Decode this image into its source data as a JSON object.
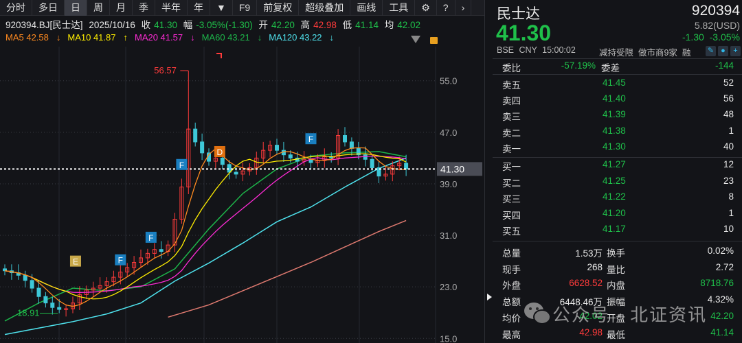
{
  "toolbar": {
    "items": [
      "分时",
      "多日",
      "日",
      "周",
      "月",
      "季",
      "半年",
      "年",
      "▼",
      "F9",
      "前复权",
      "超级叠加",
      "画线",
      "工具"
    ],
    "active": 2
  },
  "info": {
    "code": "920394.BJ[民士达]",
    "date": "2025/10/16",
    "close_label": "收",
    "close": "41.30",
    "chg_label": "幅",
    "chg": "-3.05%(-1.30)",
    "open_label": "开",
    "open": "42.20",
    "high_label": "高",
    "high": "42.98",
    "low_label": "低",
    "low": "41.14",
    "avg_label": "均",
    "avg": "42.02"
  },
  "ma": [
    {
      "label": "MA5 42.58",
      "arrow": "↓",
      "color": "#ff8a1f"
    },
    {
      "label": "MA10 41.87",
      "arrow": "↑",
      "color": "#ffee00"
    },
    {
      "label": "MA20 41.57",
      "arrow": "↓",
      "color": "#ff2bd6"
    },
    {
      "label": "MA60 43.21",
      "arrow": "↓",
      "color": "#1db54a"
    },
    {
      "label": "MA120 43.22",
      "arrow": "↓",
      "color": "#4fe3ee"
    }
  ],
  "chart_data": {
    "type": "candlestick",
    "ylim": [
      15,
      57
    ],
    "yticks": [
      "55.0",
      "47.0",
      "39.0",
      "31.0",
      "23.0",
      "15.0"
    ],
    "yticks_values": [
      55,
      47,
      39,
      31,
      23,
      15
    ],
    "closes": [
      25.5,
      25.2,
      24.8,
      24.0,
      22.8,
      21.5,
      20.5,
      19.8,
      19.5,
      19.6,
      20.5,
      21.8,
      22.5,
      22.8,
      23.2,
      23.8,
      24.5,
      25.3,
      26.0,
      26.8,
      27.5,
      28.2,
      28.8,
      28.5,
      29.5,
      33.5,
      38.5,
      47.5,
      45.5,
      43.8,
      42.5,
      43.0,
      42.0,
      40.8,
      40.5,
      41.0,
      41.5,
      43.0,
      44.2,
      45.0,
      44.2,
      43.5,
      43.0,
      42.5,
      42.8,
      42.3,
      42.6,
      43.2,
      43.0,
      46.5,
      45.5,
      44.5,
      43.5,
      42.8,
      41.5,
      40.2,
      40.5,
      41.8,
      42.2,
      41.3
    ],
    "max_label": "56.57",
    "max_value": 56.57,
    "max_index": 27,
    "min_label": "18.91",
    "min_value": 18.91,
    "min_index": 8,
    "last_price_label": "41.30",
    "last_price": 41.3,
    "ma60": [
      [
        0,
        17.7
      ],
      [
        5,
        20.5
      ],
      [
        10,
        22.8
      ],
      [
        15,
        22.4
      ],
      [
        20,
        23
      ],
      [
        25,
        25.8
      ],
      [
        30,
        32
      ],
      [
        35,
        37.5
      ],
      [
        40,
        41.3
      ],
      [
        45,
        43.3
      ],
      [
        50,
        43.8
      ],
      [
        55,
        44
      ],
      [
        59,
        43.2
      ]
    ],
    "ma120": [
      [
        0,
        15.6
      ],
      [
        5,
        16.6
      ],
      [
        10,
        17.6
      ],
      [
        15,
        18.8
      ],
      [
        20,
        20.5
      ],
      [
        25,
        23.9
      ],
      [
        30,
        26.7
      ],
      [
        35,
        29.8
      ],
      [
        40,
        33.1
      ],
      [
        45,
        35.4
      ],
      [
        50,
        38.5
      ],
      [
        55,
        41.4
      ],
      [
        59,
        43
      ]
    ],
    "ma250": [
      [
        24,
        18.3
      ],
      [
        30,
        20.2
      ],
      [
        35,
        22.4
      ],
      [
        40,
        24.6
      ],
      [
        45,
        26.8
      ],
      [
        50,
        29.2
      ],
      [
        55,
        31.6
      ],
      [
        59,
        33.3
      ]
    ],
    "markers": [
      {
        "label": "E",
        "index": 10.4,
        "price": 27,
        "color": "#c9a94a"
      },
      {
        "label": "F",
        "index": 17,
        "price": 27.2,
        "color": "#1a7fc0"
      },
      {
        "label": "F",
        "index": 21.5,
        "price": 30.7,
        "color": "#1a7fc0"
      },
      {
        "label": "F",
        "index": 26,
        "price": 42,
        "color": "#1a7fc0"
      },
      {
        "label": "D",
        "index": 31.6,
        "price": 44,
        "color": "#e07010"
      },
      {
        "label": "F",
        "index": 45,
        "price": 46,
        "color": "#1a7fc0"
      }
    ],
    "colors": {
      "up": "#ff3b3b",
      "down": "#3ec8d8"
    }
  },
  "quote": {
    "name": "民士达",
    "code": "920394",
    "price": "41.30",
    "usd": "5.82(USD)",
    "chg": "-1.30",
    "pct": "-3.05%",
    "exchange": "BSE",
    "currency": "CNY",
    "time": "15:00:02",
    "tags": "减持受限  做市商9家  融"
  },
  "ratio": {
    "label1": "委比",
    "val1": "-57.19%",
    "label2": "委差",
    "val2": "-144"
  },
  "asks": [
    {
      "l": "卖五",
      "p": "41.45",
      "v": "52"
    },
    {
      "l": "卖四",
      "p": "41.40",
      "v": "56"
    },
    {
      "l": "卖三",
      "p": "41.39",
      "v": "48"
    },
    {
      "l": "卖二",
      "p": "41.38",
      "v": "1"
    },
    {
      "l": "卖一",
      "p": "41.30",
      "v": "40"
    }
  ],
  "bids": [
    {
      "l": "买一",
      "p": "41.27",
      "v": "12"
    },
    {
      "l": "买二",
      "p": "41.25",
      "v": "23"
    },
    {
      "l": "买三",
      "p": "41.22",
      "v": "8"
    },
    {
      "l": "买四",
      "p": "41.20",
      "v": "1"
    },
    {
      "l": "买五",
      "p": "41.17",
      "v": "10"
    }
  ],
  "stats": [
    {
      "l1": "总量",
      "v1": "1.53万",
      "c1": "w",
      "l2": "换手",
      "v2": "0.02%",
      "c2": "w"
    },
    {
      "l1": "现手",
      "v1": "268",
      "c1": "w",
      "l2": "量比",
      "v2": "2.72",
      "c2": "w"
    },
    {
      "l1": "外盘",
      "v1": "6628.52",
      "c1": "r",
      "l2": "内盘",
      "v2": "8718.76",
      "c2": "g"
    },
    {
      "l1": "总额",
      "v1": "6448.46万",
      "c1": "w",
      "l2": "振幅",
      "v2": "4.32%",
      "c2": "w"
    },
    {
      "l1": "均价",
      "v1": "42.02",
      "c1": "g",
      "l2": "开盘",
      "v2": "42.20",
      "c2": "g"
    },
    {
      "l1": "最高",
      "v1": "42.98",
      "c1": "r",
      "l2": "最低",
      "v2": "41.14",
      "c2": "g"
    }
  ],
  "watermark": "公众号 · 北证资讯"
}
